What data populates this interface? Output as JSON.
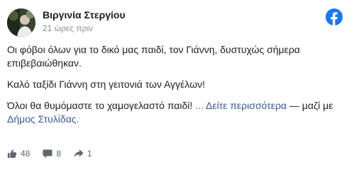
{
  "post": {
    "author": "Βιργινία Στεργίου",
    "time": "21 ώρες πριν",
    "paragraphs": [
      "Οι φόβοι όλων για το δικό μας παιδί, τον Γιάννη, δυστυχώς σήμερα επιβεβαιώθηκαν.",
      "Καλό ταξίδι Γιάννη στη γειτονιά των Αγγέλων!"
    ],
    "last_line": "Όλοι θα θυμόμαστε το χαμογελαστό παιδί!",
    "ellipsis": "...",
    "see_more": "Δείτε περισσότερα",
    "with_text": "— μαζί με",
    "tagged": "Δήμος Στυλίδας."
  },
  "stats": {
    "likes": "48",
    "comments": "8",
    "shares": "1"
  },
  "icons": {
    "brand": "facebook-logo-icon",
    "like": "thumbs-up-icon",
    "comment": "comment-icon",
    "share": "share-icon"
  },
  "colors": {
    "facebook_blue": "#1877f2",
    "link": "#385898",
    "secondary_text": "#8a8d91"
  }
}
